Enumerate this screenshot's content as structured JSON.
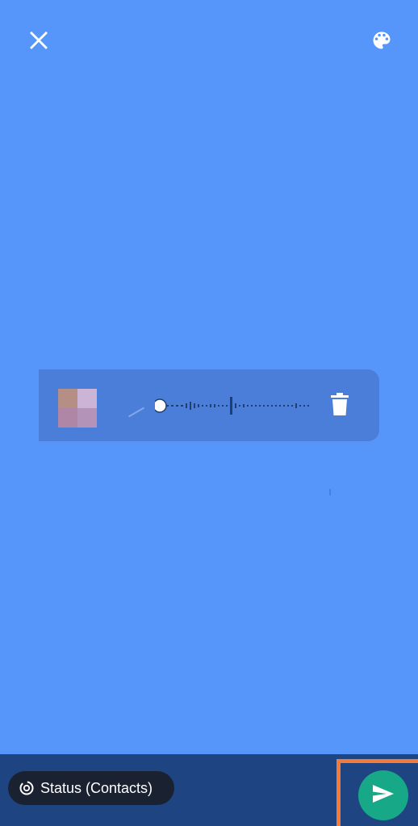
{
  "editor": {
    "background_color": "#5696FB",
    "top_bar": {
      "close_icon": "close-icon",
      "palette_icon": "palette-icon"
    },
    "voice_note": {
      "avatar": "avatar-blurred",
      "progress": 0.0,
      "delete_icon": "trash-icon"
    }
  },
  "footer": {
    "audience_label": "Status (Contacts)",
    "audience_icon": "status-icon",
    "send_icon": "send-icon",
    "send_color": "#17A887",
    "highlight_color": "#F47A39"
  }
}
